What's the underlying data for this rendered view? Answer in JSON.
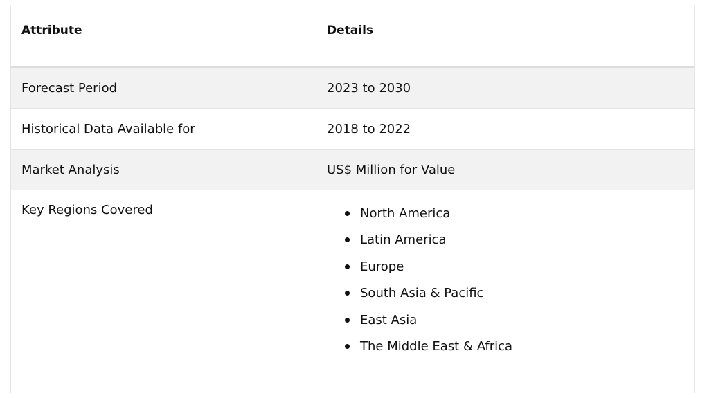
{
  "table": {
    "headers": {
      "attribute": "Attribute",
      "details": "Details"
    },
    "rows": [
      {
        "attribute": "Forecast Period",
        "details": "2023 to 2030"
      },
      {
        "attribute": "Historical Data Available for",
        "details": "2018 to 2022"
      },
      {
        "attribute": "Market Analysis",
        "details": "US$ Million for Value"
      }
    ],
    "regions_row": {
      "attribute": "Key Regions Covered",
      "items": [
        "North America",
        "Latin America",
        "Europe",
        "South Asia & Pacific",
        "East Asia",
        "The Middle East & Africa"
      ]
    }
  }
}
